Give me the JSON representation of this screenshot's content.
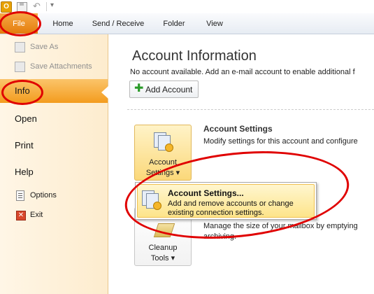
{
  "qat": {
    "app_icon": "outlook-icon",
    "save_icon": "save-icon",
    "undo_icon": "undo-icon",
    "more_icon": "customize-qat-icon"
  },
  "tabs": [
    {
      "id": "file",
      "label": "File"
    },
    {
      "id": "home",
      "label": "Home"
    },
    {
      "id": "send",
      "label": "Send / Receive"
    },
    {
      "id": "folder",
      "label": "Folder"
    },
    {
      "id": "view",
      "label": "View"
    }
  ],
  "backstage": {
    "commands": {
      "save_as": "Save As",
      "save_attachments": "Save Attachments"
    },
    "nav": {
      "info": "Info",
      "open": "Open",
      "print": "Print",
      "help": "Help",
      "options": "Options",
      "exit": "Exit"
    }
  },
  "main": {
    "title": "Account Information",
    "subtitle": "No account available. Add an e-mail account to enable additional f",
    "add_account": "Add Account",
    "account_settings": {
      "btn_line1": "Account",
      "btn_line2": "Settings ▾",
      "title": "Account Settings",
      "desc": "Modify settings for this account and configure"
    },
    "cleanup": {
      "btn_line1": "Cleanup",
      "btn_line2": "Tools ▾",
      "desc1": "Manage the size of your mailbox by emptying",
      "desc2": "archiving."
    }
  },
  "menu": {
    "item_title": "Account Settings...",
    "item_desc1": "Add and remove accounts or change",
    "item_desc2": "existing connection settings."
  },
  "colors": {
    "file_tab": "#e47d0c",
    "selection": "#f39c1e",
    "annotation": "#e00000"
  }
}
